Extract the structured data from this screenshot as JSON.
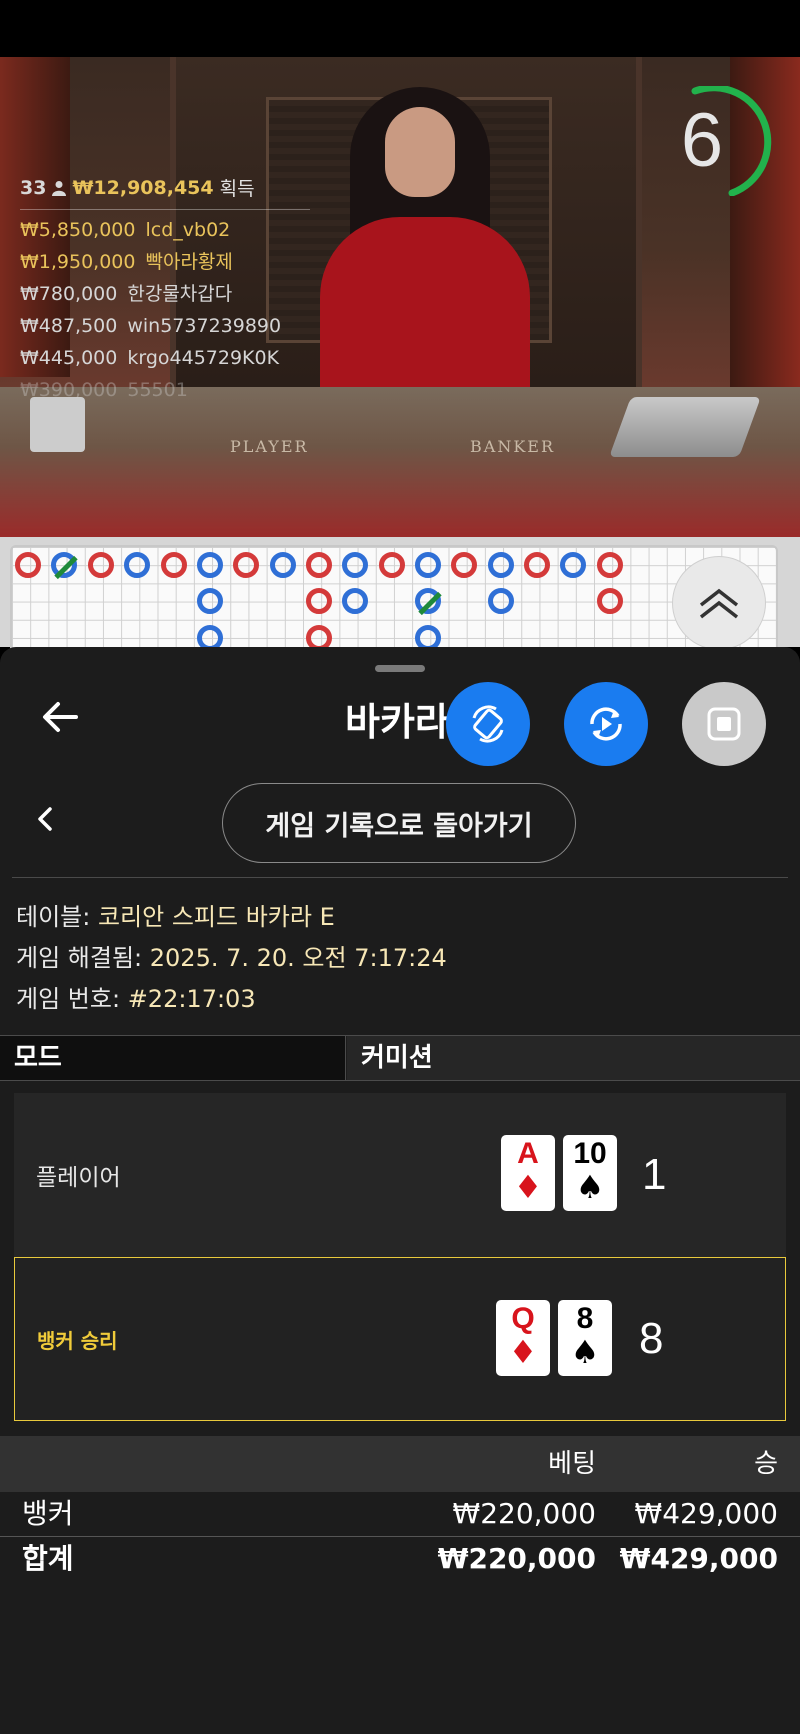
{
  "video": {
    "table_labels": [
      "PLAYER",
      "BANKER"
    ],
    "timer": "6",
    "winners_header": {
      "count": "33",
      "amount": "₩12,908,454",
      "suffix": "획득"
    },
    "winners": [
      {
        "amount": "₩5,850,000",
        "name": "lcd_vb02"
      },
      {
        "amount": "₩1,950,000",
        "name": "빡아라황제"
      },
      {
        "amount": "₩780,000",
        "name": "한강물차갑다"
      },
      {
        "amount": "₩487,500",
        "name": "win5737239890"
      },
      {
        "amount": "₩445,000",
        "name": "krgo445729K0K"
      },
      {
        "amount": "₩390,000",
        "name": "55501"
      }
    ]
  },
  "sheet": {
    "title": "바카라",
    "history_button": "게임 기록으로 돌아가기",
    "info": {
      "table_label": "테이블:",
      "table_value": "코리안 스피드 바카라 E",
      "resolved_label": "게임 해결됨:",
      "resolved_value": "2025. 7. 20. 오전 7:17:24",
      "number_label": "게임 번호:",
      "number_value": "#22:17:03"
    },
    "mode_label": "모드",
    "mode_value": "커미션",
    "player": {
      "label": "플레이어",
      "cards": [
        {
          "rank": "A",
          "suit": "♦",
          "color": "red"
        },
        {
          "rank": "10",
          "suit": "♠",
          "color": "black"
        }
      ],
      "score": "1"
    },
    "banker": {
      "label": "뱅커 승리",
      "cards": [
        {
          "rank": "Q",
          "suit": "♦",
          "color": "red"
        },
        {
          "rank": "8",
          "suit": "♠",
          "color": "black"
        }
      ],
      "score": "8"
    },
    "bets": {
      "header": {
        "bet": "베팅",
        "win": "승"
      },
      "rows": [
        {
          "name": "뱅커",
          "bet": "₩220,000",
          "win": "₩429,000"
        },
        {
          "name": "합계",
          "bet": "₩220,000",
          "win": "₩429,000"
        }
      ]
    }
  },
  "colors": {
    "accent_blue": "#1a7cf0",
    "banker_gold": "#e8c93c",
    "win_amount_gold": "#e9c35b",
    "timer_green": "#22b24c"
  },
  "icons": [
    "back-arrow-icon",
    "rotate-screen-icon",
    "replay-icon",
    "stop-icon",
    "chevron-left-icon",
    "double-chevron-up-icon",
    "user-icon"
  ]
}
